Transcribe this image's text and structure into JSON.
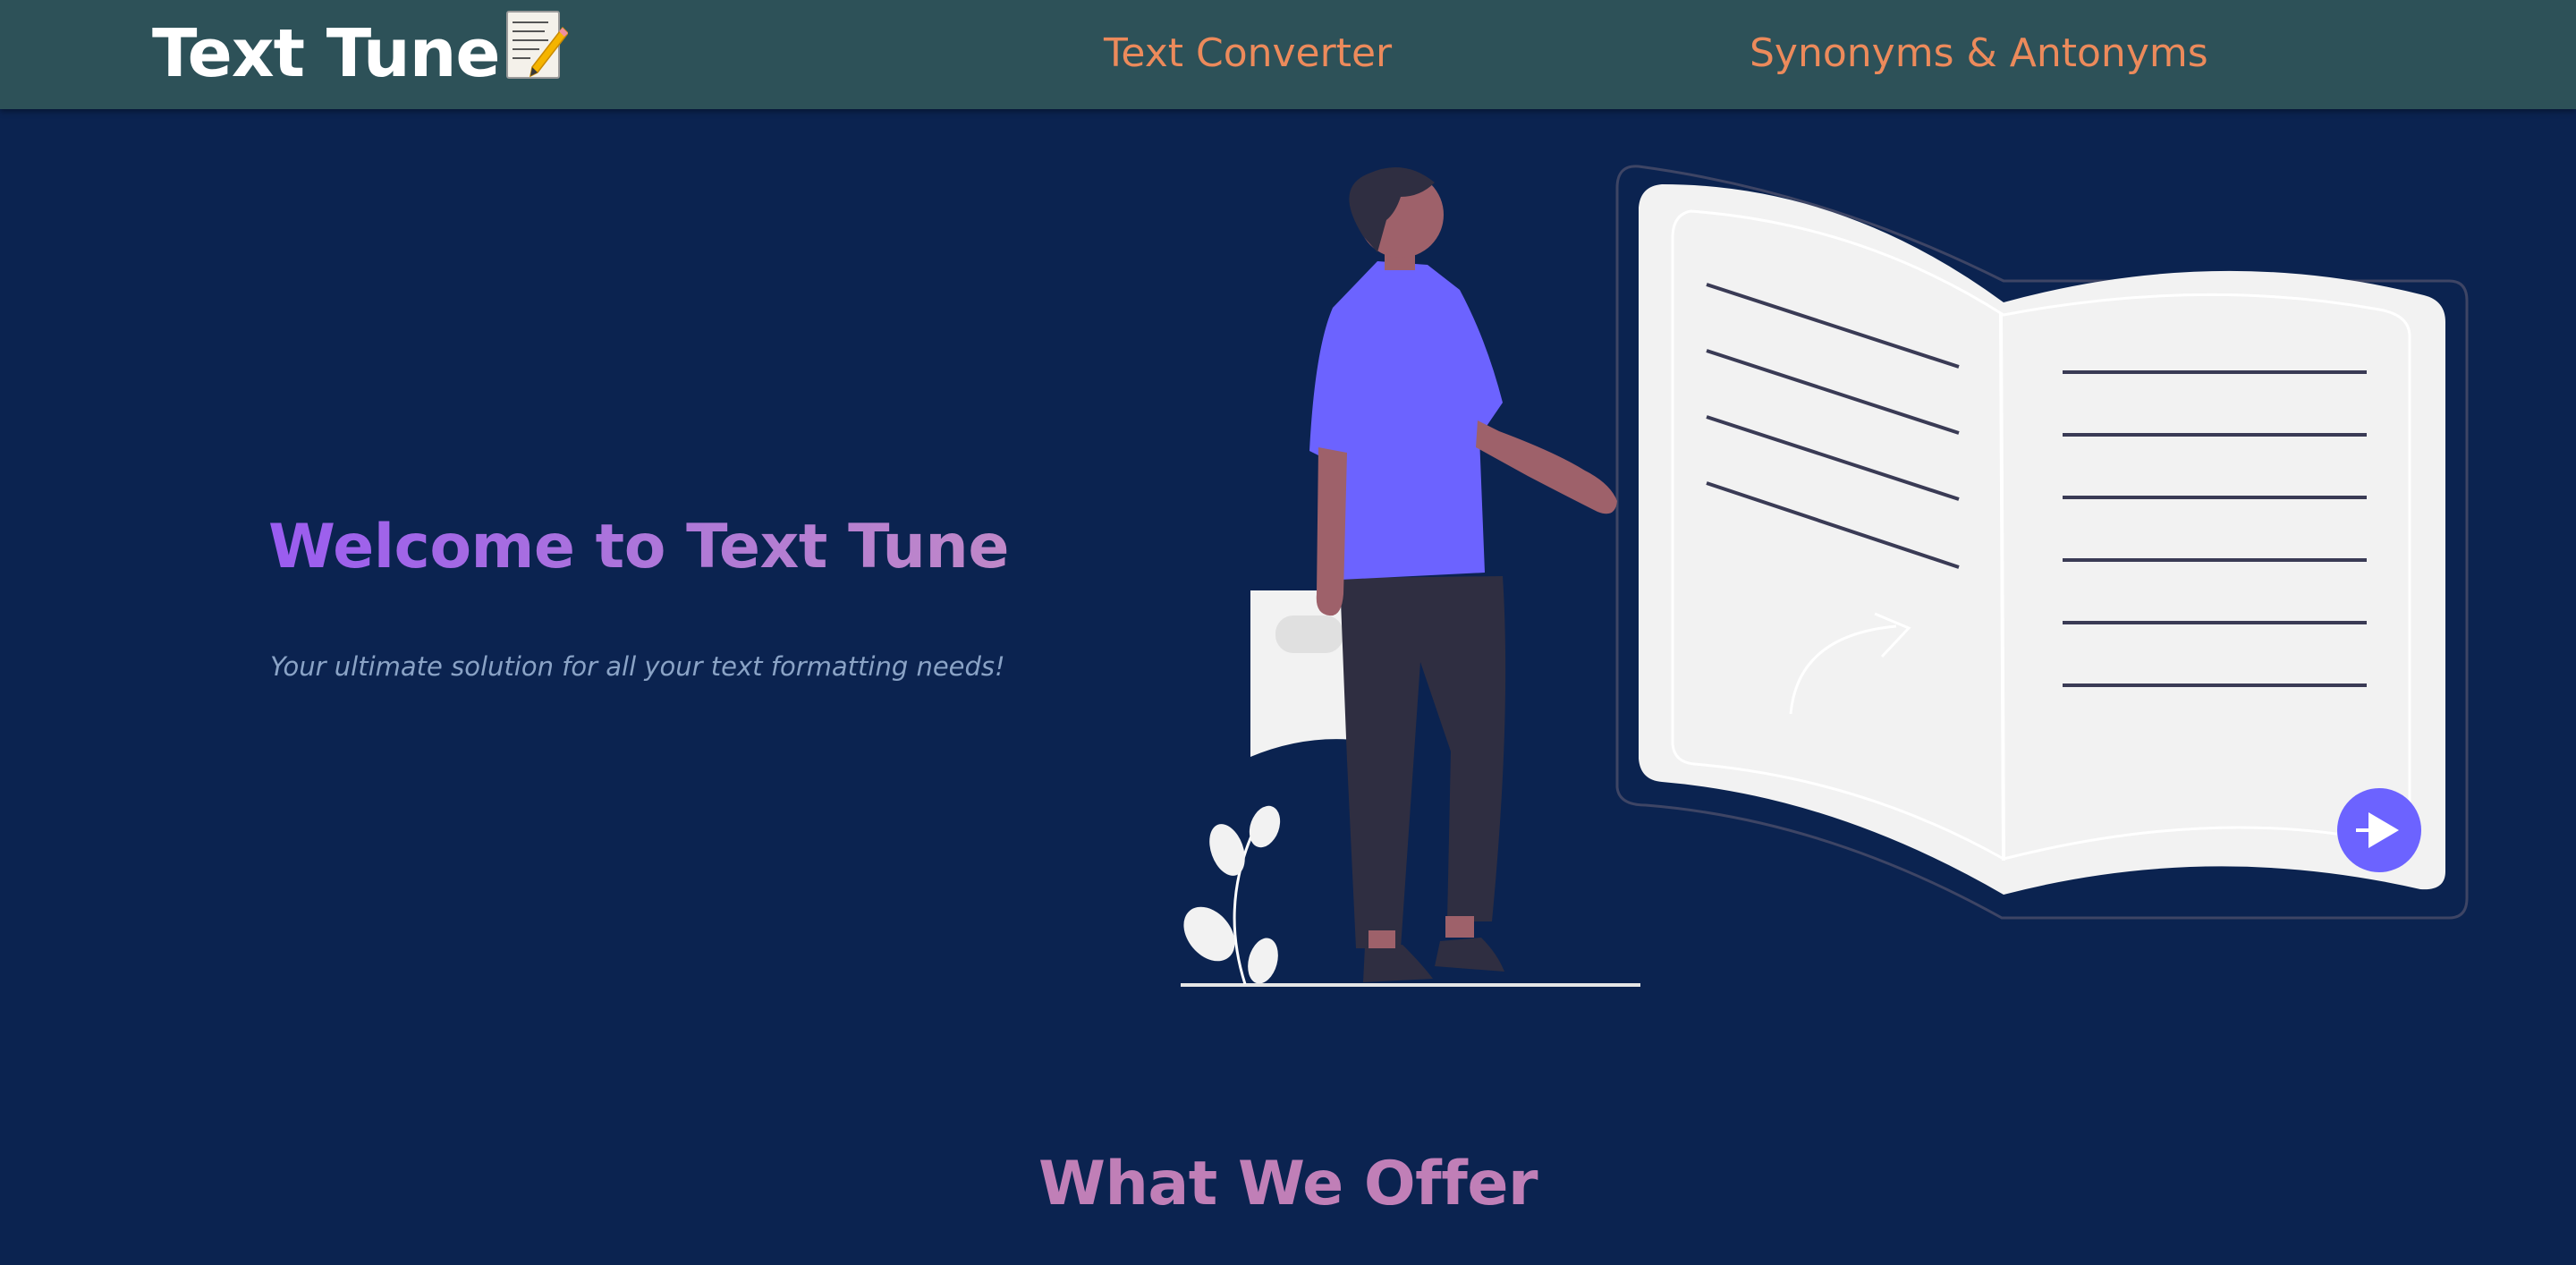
{
  "navbar": {
    "brand": "Text Tune",
    "brand_icon": "memo-pencil-icon",
    "links": [
      {
        "label": "Text Converter"
      },
      {
        "label": "Synonyms & Antonyms"
      }
    ]
  },
  "hero": {
    "title": "Welcome to Text Tune",
    "subtitle": "Your ultimate solution for all your text formatting needs!",
    "illustration": "person-reading-open-book-illustration"
  },
  "offer": {
    "title": "What We Offer"
  },
  "colors": {
    "navbar_bg": "#2d5158",
    "page_bg": "#0b2350",
    "nav_link": "#ec8a5b",
    "title_gradient_start": "#9a5cf0",
    "title_gradient_end": "#c088c8",
    "subtitle": "#8aa3c6",
    "section_title": "#c07fb7",
    "accent": "#6c63ff"
  }
}
